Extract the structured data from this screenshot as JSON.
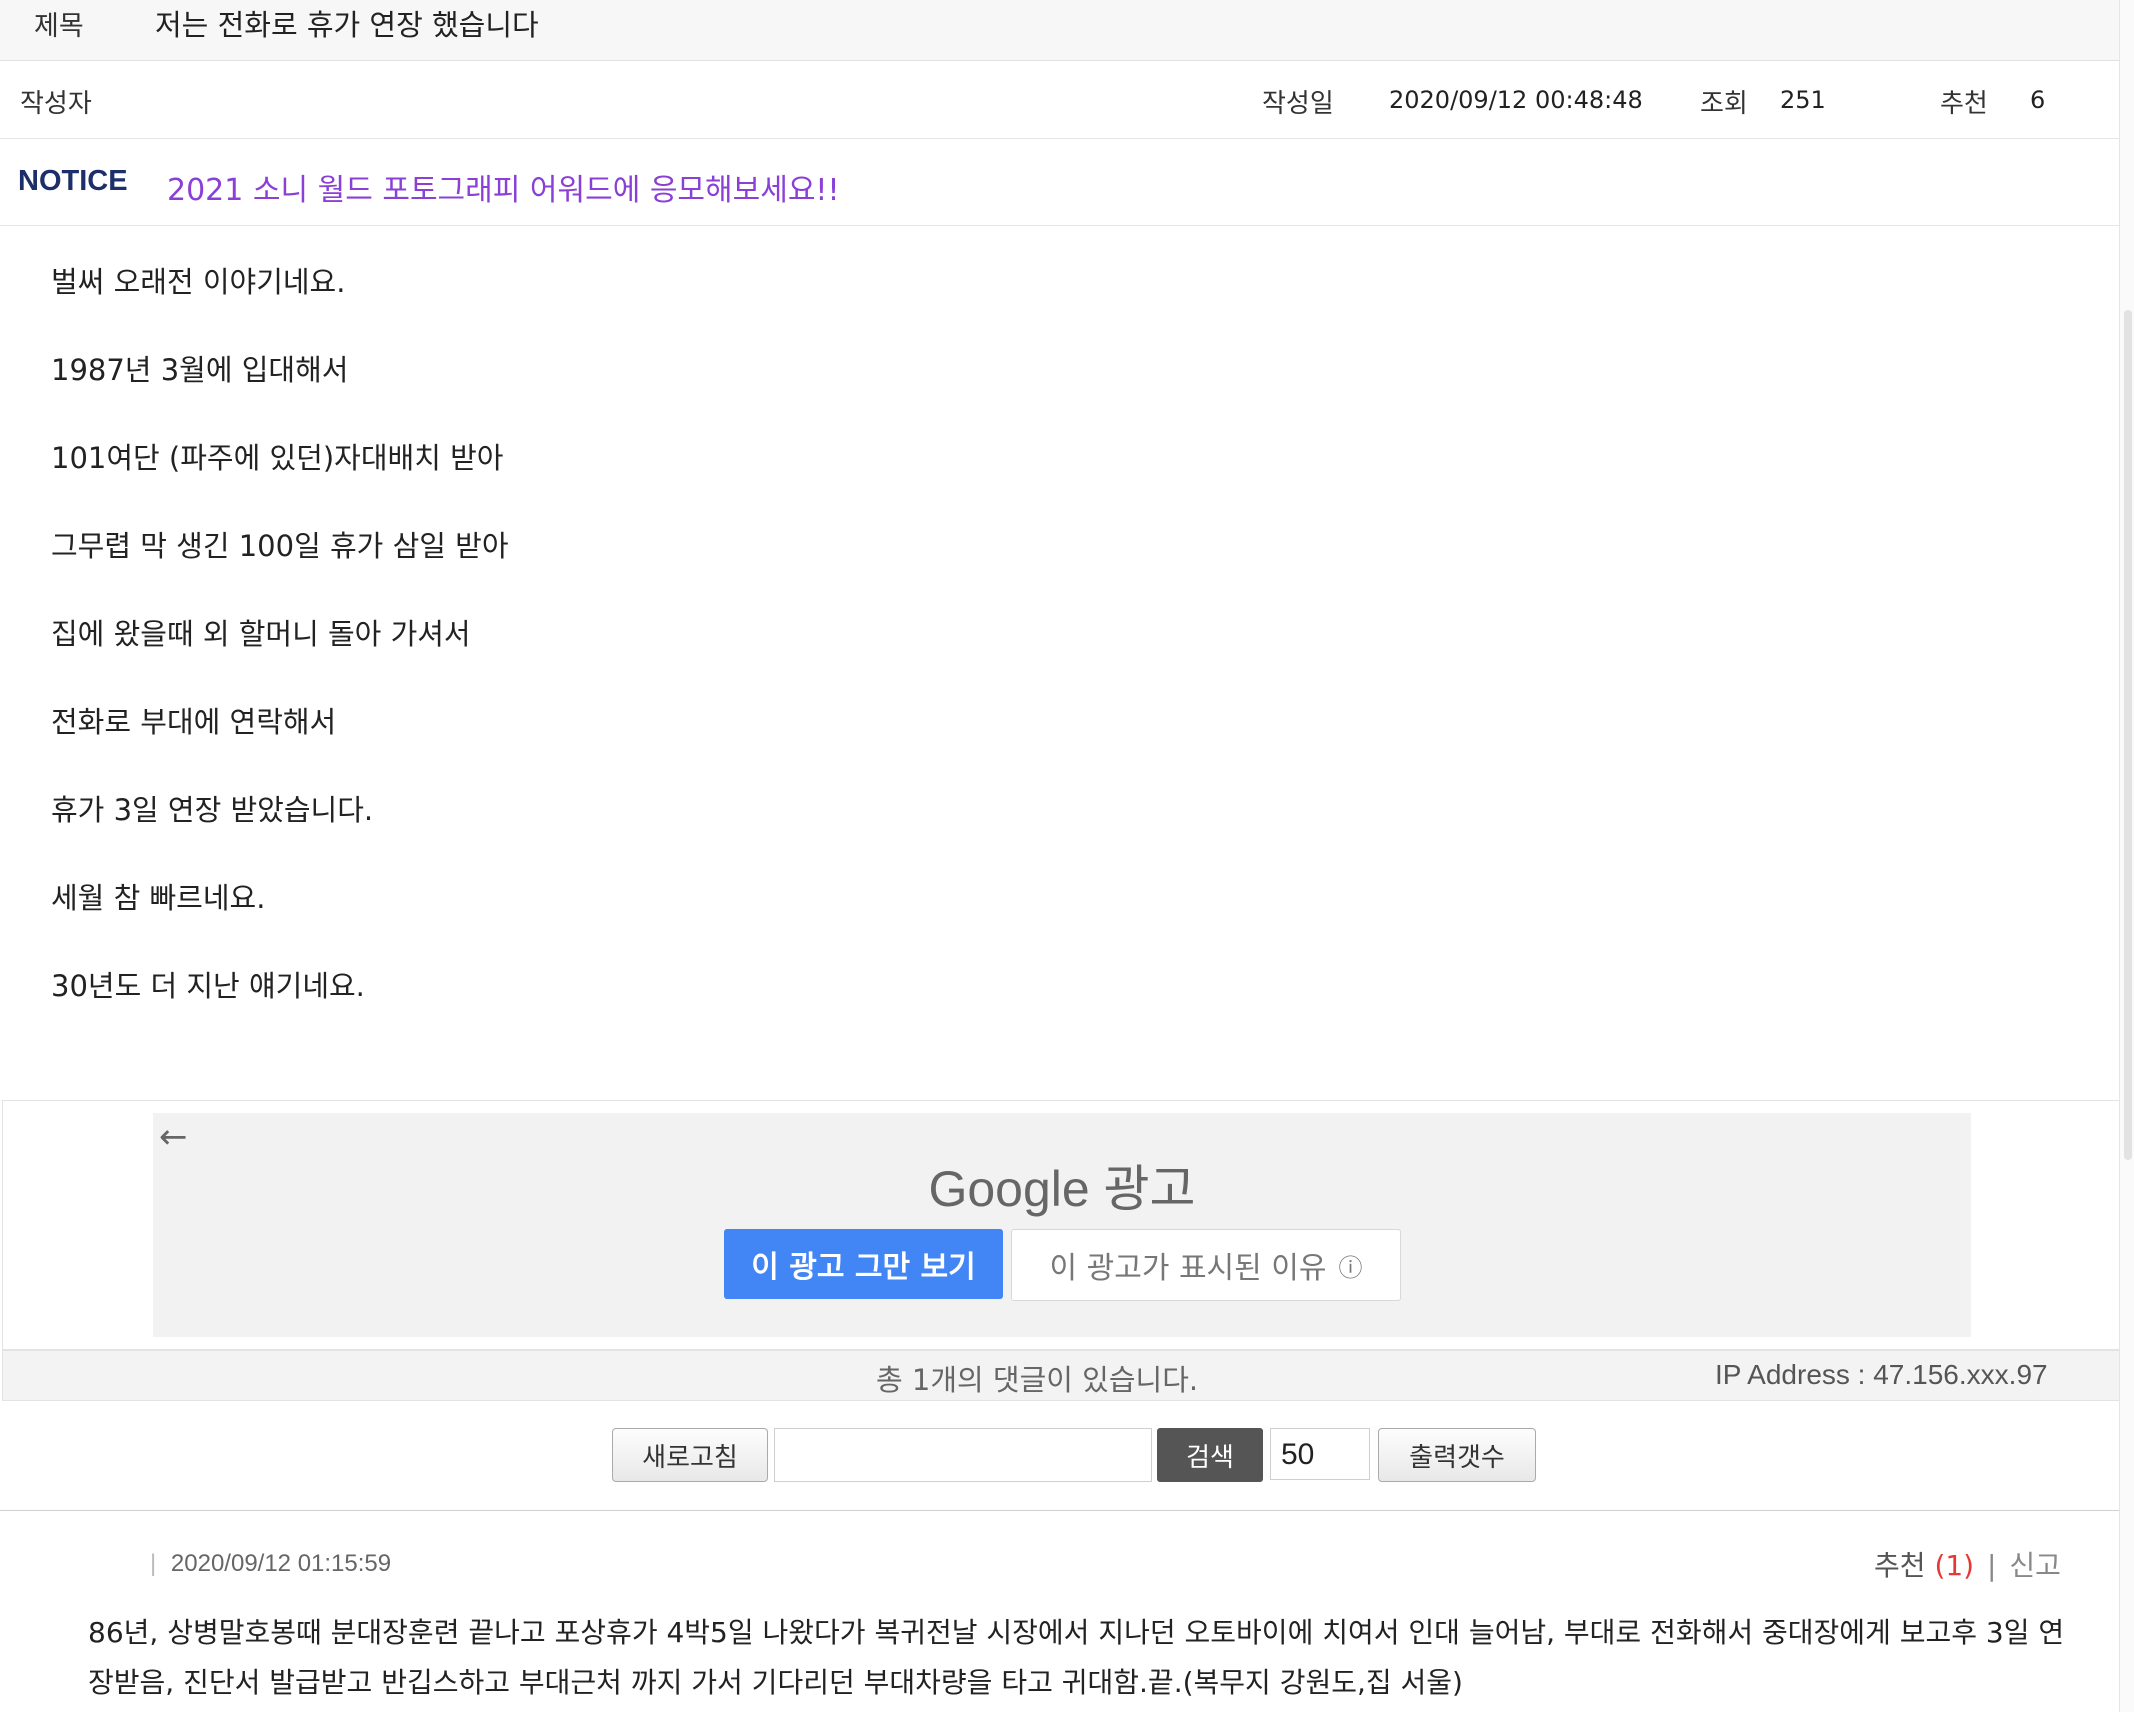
{
  "post": {
    "title_label": "제목",
    "title": "저는 전화로 휴가 연장 했습니다",
    "author_label": "작성자",
    "date_label": "작성일",
    "date": "2020/09/12 00:48:48",
    "views_label": "조회",
    "views": "251",
    "likes_label": "추천",
    "likes": "6"
  },
  "notice": {
    "tag": "NOTICE",
    "text": "2021 소니 월드 포토그래피 어워드에 응모해보세요!!"
  },
  "body": {
    "lines": [
      "벌써 오래전 이야기네요.",
      "1987년 3월에 입대해서",
      "101여단 (파주에 있던)자대배치 받아",
      "그무렵 막 생긴 100일 휴가 삼일 받아",
      "집에 왔을때 외 할머니 돌아 가셔서",
      "전화로 부대에 연락해서",
      "휴가 3일 연장 받았습니다.",
      "세월 참 빠르네요.",
      "30년도 더 지난 얘기네요."
    ]
  },
  "ad": {
    "back_icon": "←",
    "logo": "Google 광고",
    "stop_button": "이 광고 그만 보기",
    "why_button": "이 광고가 표시된 이유",
    "info_icon": "ⓘ"
  },
  "comments_bar": {
    "count_text": "총 1개의 댓글이 있습니다.",
    "ip_text": "IP Address : 47.156.xxx.97"
  },
  "toolbar": {
    "refresh_label": "새로고침",
    "search_value": "",
    "search_label": "검색",
    "count_value": "50",
    "count_label": "출력갯수"
  },
  "comment": {
    "tick": "|",
    "date": "2020/09/12 01:15:59",
    "likes_label": "추천",
    "likes_value": "(1)",
    "sep": "|",
    "report_label": "신고",
    "text": "86년, 상병말호봉때 분대장훈련 끝나고 포상휴가 4박5일 나왔다가 복귀전날 시장에서 지나던 오토바이에 치여서 인대 늘어남, 부대로 전화해서 중대장에게 보고후 3일 연장받음, 진단서 발급받고 반깁스하고 부대근처 까지 가서 기다리던 부대차량을 타고 귀대함.끝.(복무지 강원도,집 서울)"
  },
  "colors": {
    "notice_tag": "#1d2f6b",
    "notice_link": "#8a3fd6",
    "ad_stop_button": "#4285f4",
    "search_button": "#555555",
    "like_count": "#e53935"
  }
}
